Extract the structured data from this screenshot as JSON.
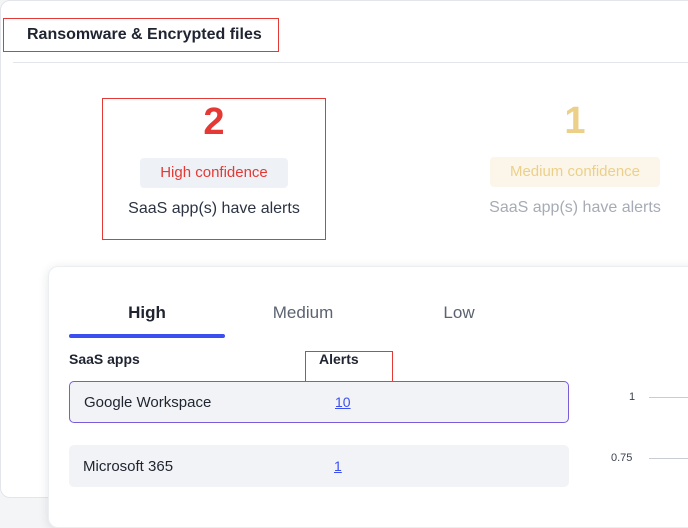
{
  "section": {
    "title": "Ransomware & Encrypted files"
  },
  "stats": {
    "high": {
      "count": "2",
      "badge": "High confidence",
      "caption": "SaaS app(s) have alerts"
    },
    "medium": {
      "count": "1",
      "badge": "Medium confidence",
      "caption": "SaaS app(s) have alerts"
    }
  },
  "panel": {
    "tabs": [
      {
        "label": "High"
      },
      {
        "label": "Medium"
      },
      {
        "label": "Low"
      }
    ],
    "columns": {
      "apps": "SaaS apps",
      "alerts": "Alerts"
    },
    "rows": [
      {
        "app": "Google Workspace",
        "alerts": "10"
      },
      {
        "app": "Microsoft 365",
        "alerts": "1"
      }
    ],
    "chart_ticks": [
      "1",
      "0.75"
    ]
  },
  "colors": {
    "high": "#e53935",
    "medium": "#ecd08a",
    "tab_accent": "#3b4ff0",
    "selected_row_border": "#7a5cd9"
  }
}
